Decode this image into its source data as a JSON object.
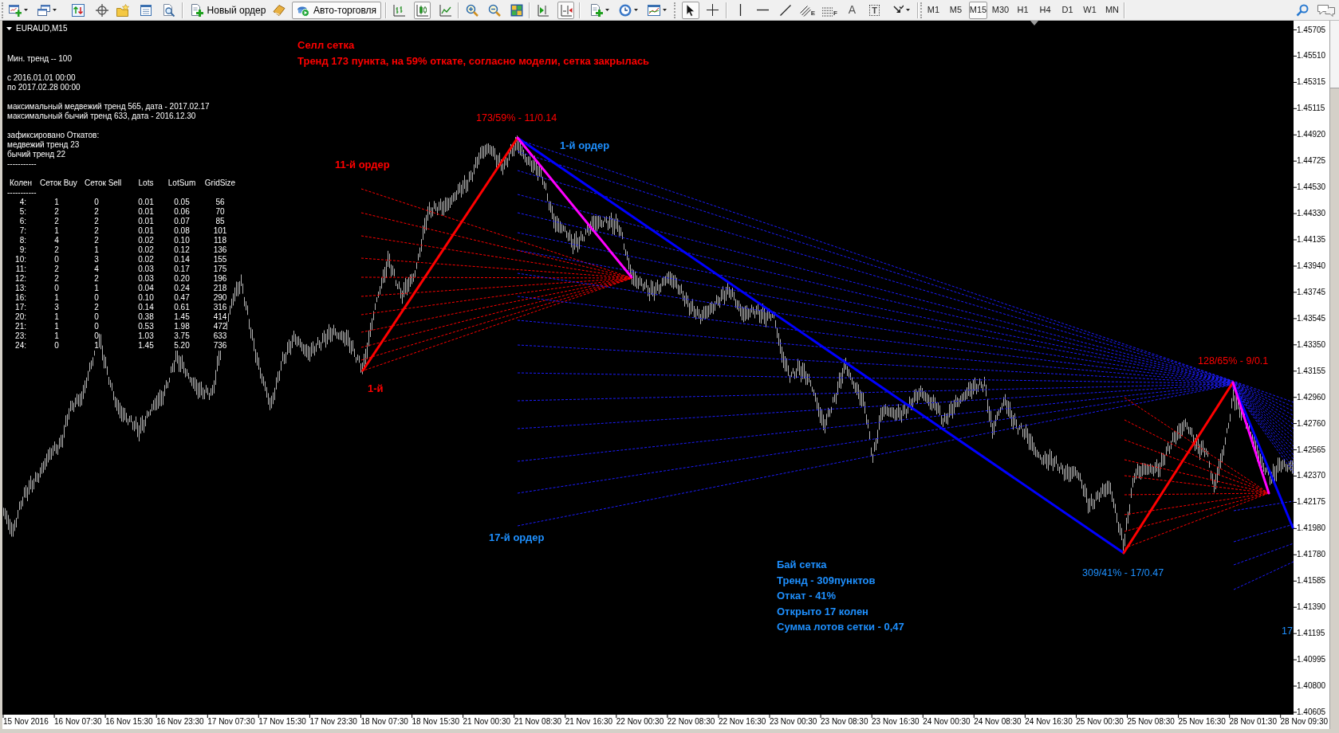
{
  "toolbar": {
    "new_order": {
      "label": "Новый ордер"
    },
    "auto_trading": {
      "label": "Авто-торговля",
      "pressed": true
    },
    "chart_modes": [
      {
        "kind": "bars",
        "selected": false
      },
      {
        "kind": "candles",
        "selected": true
      },
      {
        "kind": "line",
        "selected": false
      }
    ],
    "scroll_modes": [
      {
        "kind": "auto_scroll",
        "on": false
      },
      {
        "kind": "chart_shift",
        "on": true
      }
    ],
    "cursor_modes": [
      {
        "kind": "cursor",
        "selected": true
      },
      {
        "kind": "crosshair",
        "selected": false
      }
    ],
    "drawing_tools": [
      {
        "kind": "vertical_line"
      },
      {
        "kind": "horizontal_line"
      },
      {
        "kind": "trendline"
      },
      {
        "kind": "channel",
        "glyph": "E"
      },
      {
        "kind": "fibonacci",
        "glyph": "F"
      },
      {
        "kind": "text",
        "glyph": "A"
      },
      {
        "kind": "text_label",
        "glyph": "T"
      },
      {
        "kind": "arrows"
      }
    ],
    "timeframes": [
      {
        "label": "M1",
        "selected": false
      },
      {
        "label": "M5",
        "selected": false
      },
      {
        "label": "M15",
        "selected": true
      },
      {
        "label": "M30",
        "selected": false
      },
      {
        "label": "H1",
        "selected": false
      },
      {
        "label": "H4",
        "selected": false
      },
      {
        "label": "D1",
        "selected": false
      },
      {
        "label": "W1",
        "selected": false
      },
      {
        "label": "MN",
        "selected": false
      }
    ]
  },
  "chart": {
    "title": "EURAUD,M15",
    "info_panel": {
      "blocks": [
        [
          "Мин. тренд -- 100"
        ],
        [
          "с 2016.01.01 00:00",
          "по 2017.02.28 00:00"
        ],
        [
          "максимальный медвежий тренд 565, дата - 2017.02.17",
          "максимальный бычий тренд 633, дата - 2016.12.30"
        ],
        [
          "зафиксировано Откатов:",
          "медвежий тренд 23",
          "бычий тренд 22",
          "-----------"
        ]
      ],
      "table": {
        "columns": [
          "Колен",
          "Сеток Buy",
          "Сеток Sell",
          "Lots",
          "LotSum",
          "GridSize"
        ],
        "separator": "-----------",
        "rows": [
          [
            "4:",
            "1",
            "0",
            "0.01",
            "0.05",
            "56"
          ],
          [
            "5:",
            "2",
            "2",
            "0.01",
            "0.06",
            "70"
          ],
          [
            "6:",
            "2",
            "2",
            "0.01",
            "0.07",
            "85"
          ],
          [
            "7:",
            "1",
            "2",
            "0.01",
            "0.08",
            "101"
          ],
          [
            "8:",
            "4",
            "2",
            "0.02",
            "0.10",
            "118"
          ],
          [
            "9:",
            "2",
            "1",
            "0.02",
            "0.12",
            "136"
          ],
          [
            "10:",
            "0",
            "3",
            "0.02",
            "0.14",
            "155"
          ],
          [
            "11:",
            "2",
            "4",
            "0.03",
            "0.17",
            "175"
          ],
          [
            "12:",
            "2",
            "2",
            "0.03",
            "0.20",
            "196"
          ],
          [
            "13:",
            "0",
            "1",
            "0.04",
            "0.24",
            "218"
          ],
          [
            "16:",
            "1",
            "0",
            "0.10",
            "0.47",
            "290"
          ],
          [
            "17:",
            "3",
            "2",
            "0.14",
            "0.61",
            "316"
          ],
          [
            "20:",
            "1",
            "0",
            "0.38",
            "1.45",
            "414"
          ],
          [
            "21:",
            "1",
            "0",
            "0.53",
            "1.98",
            "472"
          ],
          [
            "23:",
            "1",
            "0",
            "1.03",
            "3.75",
            "633"
          ],
          [
            "24:",
            "0",
            "1",
            "1.45",
            "5.20",
            "736"
          ]
        ]
      }
    },
    "annotations": [
      {
        "kind": "note",
        "color": "#ff0000",
        "lines": [
          "Селл сетка",
          "Тренд 173 пункта, на 59% откате, согласно модели, сетка закрылась"
        ]
      },
      {
        "kind": "level",
        "color": "#ff0000",
        "text": "173/59% - 11/0.14"
      },
      {
        "kind": "order",
        "color": "#1e90ff",
        "text": "1-й ордер"
      },
      {
        "kind": "order",
        "color": "#ff0000",
        "text": "11-й ордер"
      },
      {
        "kind": "level",
        "color": "#ff0000",
        "text": "128/65% - 9/0.1"
      },
      {
        "kind": "order",
        "color": "#ff0000",
        "text": "1-й"
      },
      {
        "kind": "order",
        "color": "#1e90ff",
        "text": "17-й ордер"
      },
      {
        "kind": "note",
        "color": "#1e90ff",
        "lines": [
          "Бай сетка",
          "Тренд - 309пунктов",
          "Откат - 41%",
          "Открыто 17 колен",
          "Сумма лотов сетки - 0,47"
        ]
      },
      {
        "kind": "level",
        "color": "#1e90ff",
        "text": "309/41% - 17/0.47"
      },
      {
        "kind": "level",
        "color": "#1e90ff",
        "text": "17"
      }
    ],
    "price_axis": {
      "labels": [
        "1.45705",
        "1.45510",
        "1.45315",
        "1.45115",
        "1.44920",
        "1.44725",
        "1.44530",
        "1.44330",
        "1.44135",
        "1.43940",
        "1.43745",
        "1.43545",
        "1.43350",
        "1.43155",
        "1.42960",
        "1.42760",
        "1.42565",
        "1.42370",
        "1.42175",
        "1.41980",
        "1.41780",
        "1.41585",
        "1.41390",
        "1.41195",
        "1.40995",
        "1.40800",
        "1.40605"
      ]
    },
    "time_axis": {
      "labels": [
        "15 Nov 2016",
        "16 Nov 07:30",
        "16 Nov 15:30",
        "16 Nov 23:30",
        "17 Nov 07:30",
        "17 Nov 15:30",
        "17 Nov 23:30",
        "18 Nov 07:30",
        "18 Nov 15:30",
        "21 Nov 00:30",
        "21 Nov 08:30",
        "21 Nov 16:30",
        "22 Nov 00:30",
        "22 Nov 08:30",
        "22 Nov 16:30",
        "23 Nov 00:30",
        "23 Nov 08:30",
        "23 Nov 16:30",
        "24 Nov 00:30",
        "24 Nov 08:30",
        "24 Nov 16:30",
        "25 Nov 00:30",
        "25 Nov 08:30",
        "25 Nov 16:30",
        "28 Nov 01:30",
        "28 Nov 09:30"
      ]
    }
  }
}
